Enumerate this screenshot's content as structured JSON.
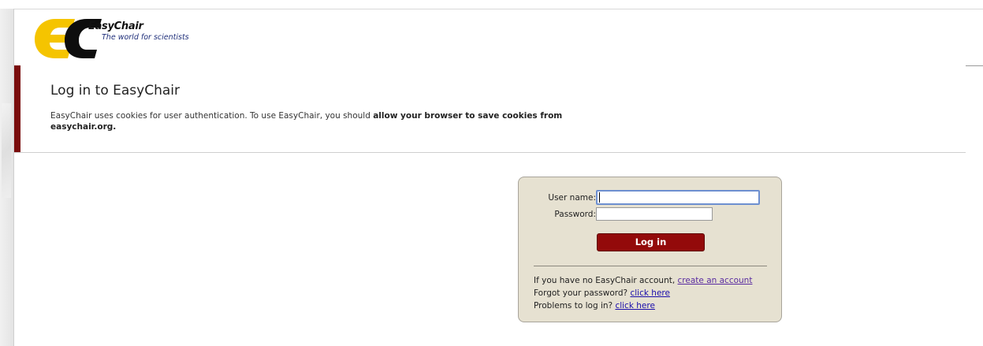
{
  "header": {
    "logo_title": "EasyChair",
    "logo_tagline": "The world for scientists",
    "logo_letters": "EC"
  },
  "page": {
    "title": "Log in to EasyChair",
    "cookie_note_prefix": "EasyChair uses cookies for user authentication. To use EasyChair, you should ",
    "cookie_note_bold": "allow your browser to save cookies from easychair.org."
  },
  "login": {
    "username_label": "User name:",
    "username_value": "",
    "password_label": "Password:",
    "password_value": "",
    "submit_label": "Log in"
  },
  "help": {
    "no_account_text": "If you have no EasyChair account, ",
    "no_account_link": "create an account",
    "forgot_text": "Forgot your password? ",
    "forgot_link": "click here",
    "problems_text": "Problems to log in? ",
    "problems_link": "click here"
  },
  "colors": {
    "accent": "#7a0c0c",
    "button": "#930a0a",
    "box_bg": "#e6e1d1",
    "link": "#1a0dab",
    "visited_link": "#5a2ca0",
    "logo_yellow": "#f5c400"
  }
}
